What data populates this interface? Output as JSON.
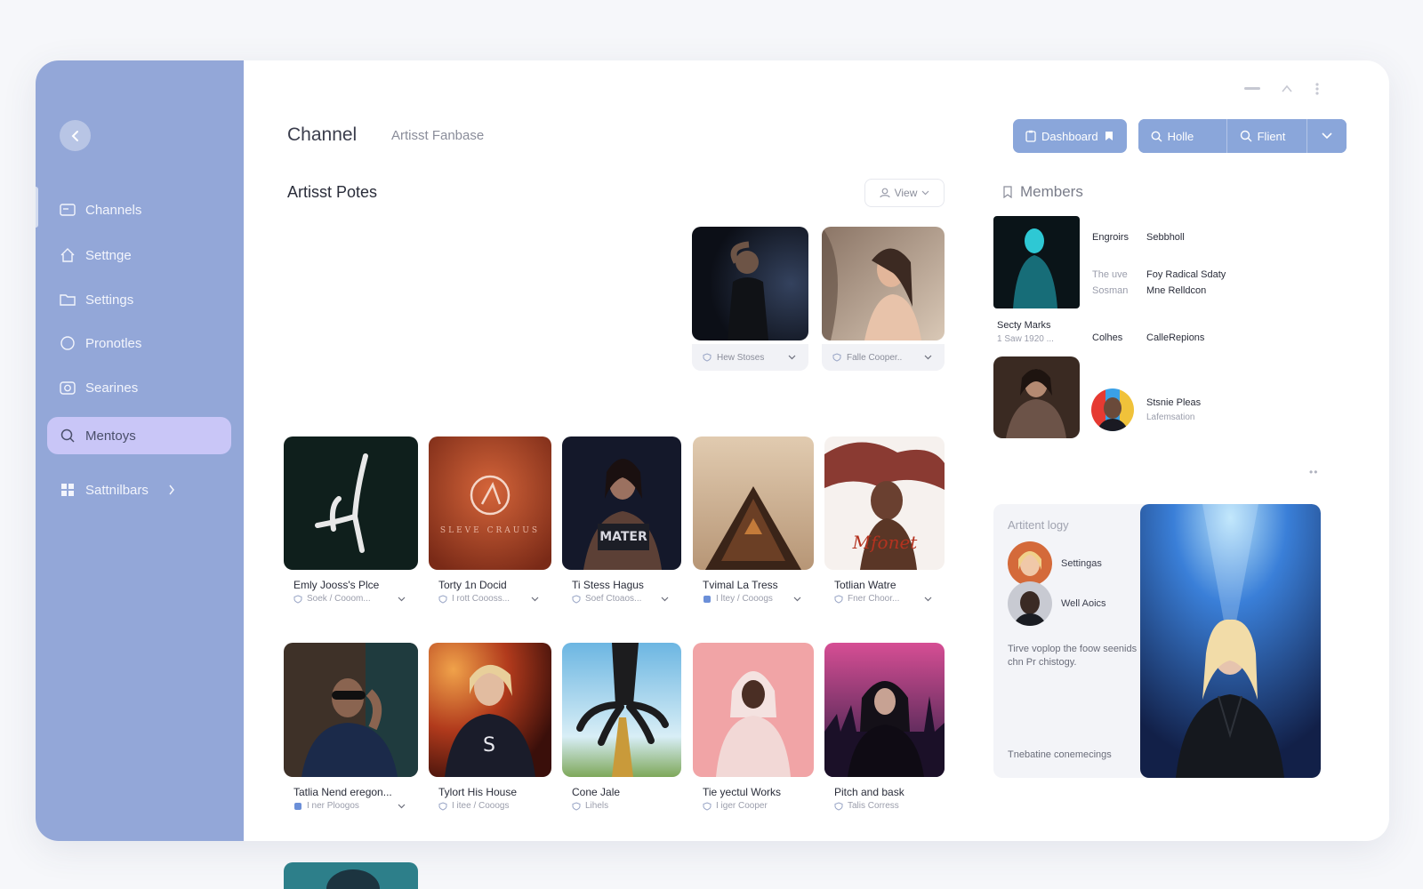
{
  "header": {
    "title": "Channel",
    "subtitle": "Artisst Fanbase"
  },
  "toolbar": {
    "dashboard": "Dashboard",
    "home": "Holle",
    "filter": "Flient"
  },
  "sidebar": {
    "items": [
      {
        "label": "Channels",
        "icon": "card-icon"
      },
      {
        "label": "Settnge",
        "icon": "house-icon"
      },
      {
        "label": "Settings",
        "icon": "folder-icon"
      },
      {
        "label": "Pronotles",
        "icon": "circle-icon"
      },
      {
        "label": "Searines",
        "icon": "camera-icon"
      },
      {
        "label": "Mentoys",
        "icon": "search-icon",
        "active": true
      },
      {
        "label": "Sattnilbars",
        "icon": "grid-icon"
      }
    ]
  },
  "section": {
    "title": "Artisst Potes",
    "view_label": "View"
  },
  "featured": [
    {
      "label": "Hew Stoses"
    },
    {
      "label": "Falle Cooper.."
    }
  ],
  "row1": [
    {
      "title": "Emly Jooss's Plce",
      "meta": "Soek / Cooom..."
    },
    {
      "title": "Torty 1n Docid",
      "meta": "I rott Coooss..."
    },
    {
      "title": "Ti Stess Hagus",
      "meta": "Soef Ctoaos..."
    },
    {
      "title": "Tvimal La Tress",
      "meta": "I ltey / Cooogs"
    },
    {
      "title": "Totlian Watre",
      "meta": "Fner Choor..."
    }
  ],
  "row2": [
    {
      "title": "Tatlia Nend eregon...",
      "meta": "I ner Ploogos"
    },
    {
      "title": "Tylort His House",
      "meta": "I itee / Cooogs"
    },
    {
      "title": "Cone Jale",
      "meta": "Lihels"
    },
    {
      "title": "Tie yectul Works",
      "meta": "I iger Cooper"
    },
    {
      "title": "Pitch and bask",
      "meta": "Talis Corress"
    }
  ],
  "album_text": {
    "red": "SLEVE CRAUUS",
    "dark": "MATER",
    "script": "Mfonet"
  },
  "members": {
    "title": "Members",
    "col_a": "Engroirs",
    "col_b": "Sebbholl",
    "row1_a": [
      "The uve",
      "Sosman"
    ],
    "row1_b": [
      "Foy Radical Sdaty",
      "Mne Relldcon"
    ],
    "person_name": "Secty Marks",
    "person_sub": "1 Saw 1920 ...",
    "collabs_a": "Colhes",
    "collabs_b": "CalleRepions",
    "card2_title": "Stsnie Pleas",
    "card2_sub": "Lafemsation"
  },
  "artist_panel": {
    "title": "Artitent logy",
    "items": [
      "Settingas",
      "Well Aoics"
    ],
    "desc": "Tirve voplop the foow seenids chn Pr chistogy.",
    "footer": "Tnebatine conemecings"
  }
}
